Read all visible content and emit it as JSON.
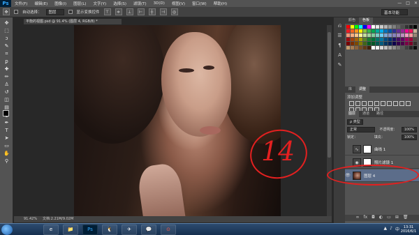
{
  "app": {
    "logo": "Ps",
    "menus": [
      "文件(F)",
      "编辑(E)",
      "图像(I)",
      "图层(L)",
      "文字(Y)",
      "选择(S)",
      "滤镜(T)",
      "3D(D)",
      "视图(V)",
      "窗口(W)",
      "帮助(H)"
    ],
    "window_controls": [
      "—",
      "□",
      "✕"
    ]
  },
  "options_bar": {
    "auto_select_label": "自动选择：",
    "auto_select_value": "图层",
    "show_transform_label": "显示变换控件",
    "workspace": "基本功能"
  },
  "document": {
    "tab_title": "平衡的视图.psd @ 91.4% (图层 4, RGB/8) *",
    "status": "91.42%",
    "doc_info": "文档:2.21M/9.02M"
  },
  "annotation": {
    "number": "14",
    "color": "#e32020"
  },
  "panels": {
    "swatch_tabs": [
      "颜色",
      "色板"
    ],
    "adjust_tabs": [
      "库",
      "调整"
    ],
    "adjust_title": "添加调整",
    "layers_tabs": [
      "图层",
      "通道",
      "路径"
    ],
    "filter_label": "ρ 类型",
    "blend_mode": "正常",
    "opacity_label": "不透明度：",
    "opacity_value": "100%",
    "lock_label": "锁定：",
    "fill_label": "填充：",
    "fill_value": "100%",
    "layers": [
      {
        "name": "曲线 1",
        "type": "adjustment",
        "visible": false
      },
      {
        "name": "照片滤镜 1",
        "type": "adjustment",
        "visible": false
      },
      {
        "name": "图层 4",
        "type": "photo",
        "visible": true,
        "selected": true
      }
    ],
    "footer_icons": [
      "∞",
      "fx",
      "◘",
      "◐",
      "▭",
      "⊞",
      "🗑"
    ]
  },
  "swatch_colors": [
    "#ff0000",
    "#ffff00",
    "#00ff00",
    "#00ffff",
    "#0000ff",
    "#ff00ff",
    "#ffffff",
    "#e6e6e6",
    "#cccccc",
    "#b3b3b3",
    "#999999",
    "#808080",
    "#666666",
    "#4d4d4d",
    "#333333",
    "#1a1a1a",
    "#000000",
    "#ed1c24",
    "#f26522",
    "#f7941d",
    "#fff200",
    "#8dc63f",
    "#39b54a",
    "#00a651",
    "#00a99d",
    "#00aeef",
    "#0072bc",
    "#0054a6",
    "#2e3192",
    "#662d91",
    "#92278f",
    "#ec008c",
    "#ed145b",
    "#c7b299",
    "#f69679",
    "#f9ad81",
    "#fdc689",
    "#fff799",
    "#c4df9b",
    "#a3d39c",
    "#82ca9c",
    "#7accc8",
    "#6dcff6",
    "#7da7d9",
    "#8393ca",
    "#8781bd",
    "#a186be",
    "#bd8cbf",
    "#f49ac1",
    "#f5989d",
    "#998675",
    "#9e0b0f",
    "#a0410d",
    "#a36209",
    "#aba000",
    "#598527",
    "#1a7b30",
    "#007236",
    "#00746b",
    "#0076a3",
    "#004b80",
    "#003471",
    "#1b1464",
    "#440e62",
    "#630460",
    "#9e005d",
    "#9e0039",
    "#534741",
    "#790000",
    "#7b2e00",
    "#7d4900",
    "#827b00",
    "#406618",
    "#005e20",
    "#005826",
    "#005952",
    "#005b7f",
    "#003663",
    "#002157",
    "#0d004c",
    "#32004b",
    "#4b0049",
    "#7b0046",
    "#7a0026",
    "#362f2d",
    "#c69c6d",
    "#a67c52",
    "#8c6239",
    "#754c24",
    "#603913",
    "#42210b",
    "#ffffff",
    "#f2f2f2",
    "#d9d9d9",
    "#bfbfbf",
    "#a6a6a6",
    "#8c8c8c",
    "#737373",
    "#595959",
    "#404040",
    "#262626",
    "#0d0d0d"
  ],
  "taskbar": {
    "apps": [
      "e",
      "📁",
      "Ps",
      "🐧",
      "✈",
      "💬",
      "⊙"
    ],
    "time": "13:31",
    "date": "2016/6/1"
  }
}
